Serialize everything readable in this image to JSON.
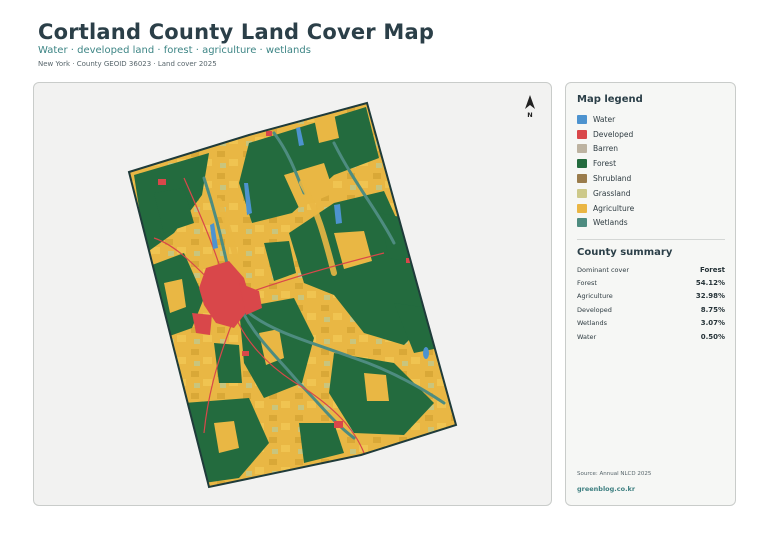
{
  "header": {
    "title": "Cortland County Land Cover Map",
    "subtitle": "Water · developed land · forest · agriculture · wetlands",
    "meta": "New York · County GEOID 36023 · Land cover 2025"
  },
  "north_arrow": {
    "label": "N"
  },
  "legend": {
    "title": "Map legend",
    "items": [
      {
        "label": "Water",
        "color": "#4d93cf"
      },
      {
        "label": "Developed",
        "color": "#d9474a"
      },
      {
        "label": "Barren",
        "color": "#bdb3a1"
      },
      {
        "label": "Forest",
        "color": "#236b3e"
      },
      {
        "label": "Shrubland",
        "color": "#9a7c4c"
      },
      {
        "label": "Grassland",
        "color": "#cdc98a"
      },
      {
        "label": "Agriculture",
        "color": "#eab644"
      },
      {
        "label": "Wetlands",
        "color": "#4e8c80"
      }
    ]
  },
  "summary": {
    "title": "County summary",
    "rows": [
      {
        "label": "Dominant cover",
        "value": "Forest"
      },
      {
        "label": "Forest",
        "value": "54.12%"
      },
      {
        "label": "Agriculture",
        "value": "32.98%"
      },
      {
        "label": "Developed",
        "value": "8.75%"
      },
      {
        "label": "Wetlands",
        "value": "3.07%"
      },
      {
        "label": "Water",
        "value": "0.50%"
      }
    ]
  },
  "footer": {
    "source": "Source: Annual NLCD 2025",
    "site": "greenblog.co.kr"
  }
}
